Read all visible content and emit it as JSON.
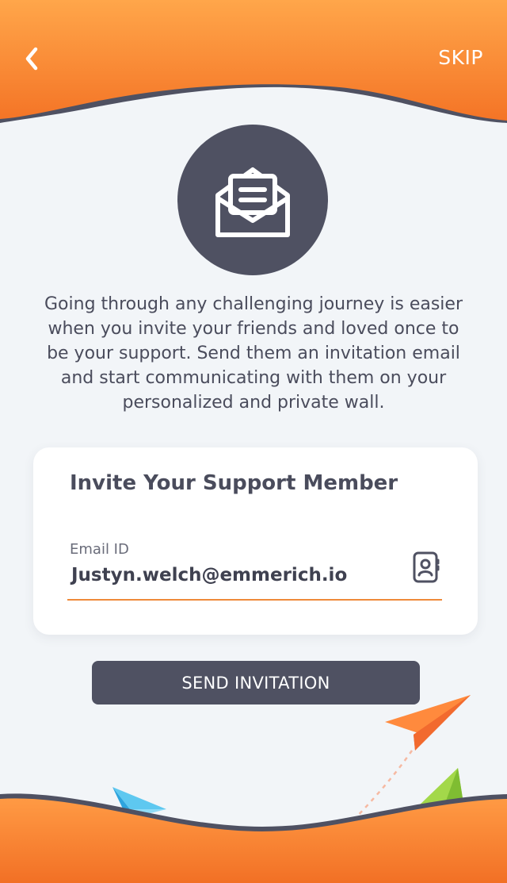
{
  "header": {
    "back_icon": "chevron-left-icon",
    "skip_label": "SKIP"
  },
  "hero": {
    "icon": "open-envelope-icon"
  },
  "intro_text": "Going through any challenging journey is easier when you invite your friends and loved once to be your support. Send them an invitation email and start communicating with them on your personalized and private wall.",
  "card": {
    "title": "Invite Your Support Member",
    "email_label": "Email ID",
    "email_value": "Justyn.welch@emmerich.io",
    "contacts_icon": "contact-book-icon"
  },
  "actions": {
    "send_label": "SEND INVITATION"
  },
  "colors": {
    "accent_orange": "#f47a2a",
    "dark": "#4f5162",
    "background": "#f2f5f8",
    "underline": "#ef8a3a"
  }
}
